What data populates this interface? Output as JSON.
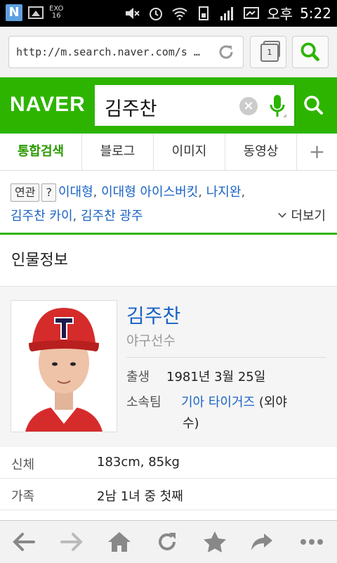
{
  "status_bar": {
    "left_icons": [
      "naver-app-icon",
      "picture-icon",
      "exo-icon"
    ],
    "exo_text": "EXO",
    "exo_num": "16",
    "n_label": "N",
    "right_icons": [
      "mute-icon",
      "alarm-icon",
      "wifi-icon",
      "sim-icon",
      "signal-icon",
      "screen-icon"
    ],
    "ampm": "오후",
    "time": "5:22"
  },
  "browser": {
    "url": "http://m.search.naver.com/s …",
    "tab_count": "1"
  },
  "header": {
    "logo": "NAVER",
    "query": "김주찬"
  },
  "tabs": [
    {
      "label": "통합검색",
      "active": true
    },
    {
      "label": "블로그"
    },
    {
      "label": "이미지"
    },
    {
      "label": "동영상"
    },
    {
      "label": "+"
    }
  ],
  "related": {
    "tag_label": "연관",
    "help_label": "?",
    "items": [
      "이대형",
      "이대형 아이스버킷",
      "나지완",
      "김주찬 카이",
      "김주찬 광주"
    ],
    "more_label": "더보기"
  },
  "section": {
    "title": "인물정보"
  },
  "profile": {
    "name": "김주찬",
    "job": "야구선수",
    "birth_label": "출생",
    "birth_value": "1981년 3월 25일",
    "team_label": "소속팀",
    "team_value": "기아 타이거즈",
    "team_pos_1": "(외야",
    "team_pos_2": "수)"
  },
  "info_rows": [
    {
      "label": "신체",
      "value": "183cm, 85kg"
    },
    {
      "label": "가족",
      "value": "2남 1녀 중 첫째"
    }
  ],
  "colors": {
    "naver_green": "#2db400",
    "link_blue": "#1a63c5"
  }
}
